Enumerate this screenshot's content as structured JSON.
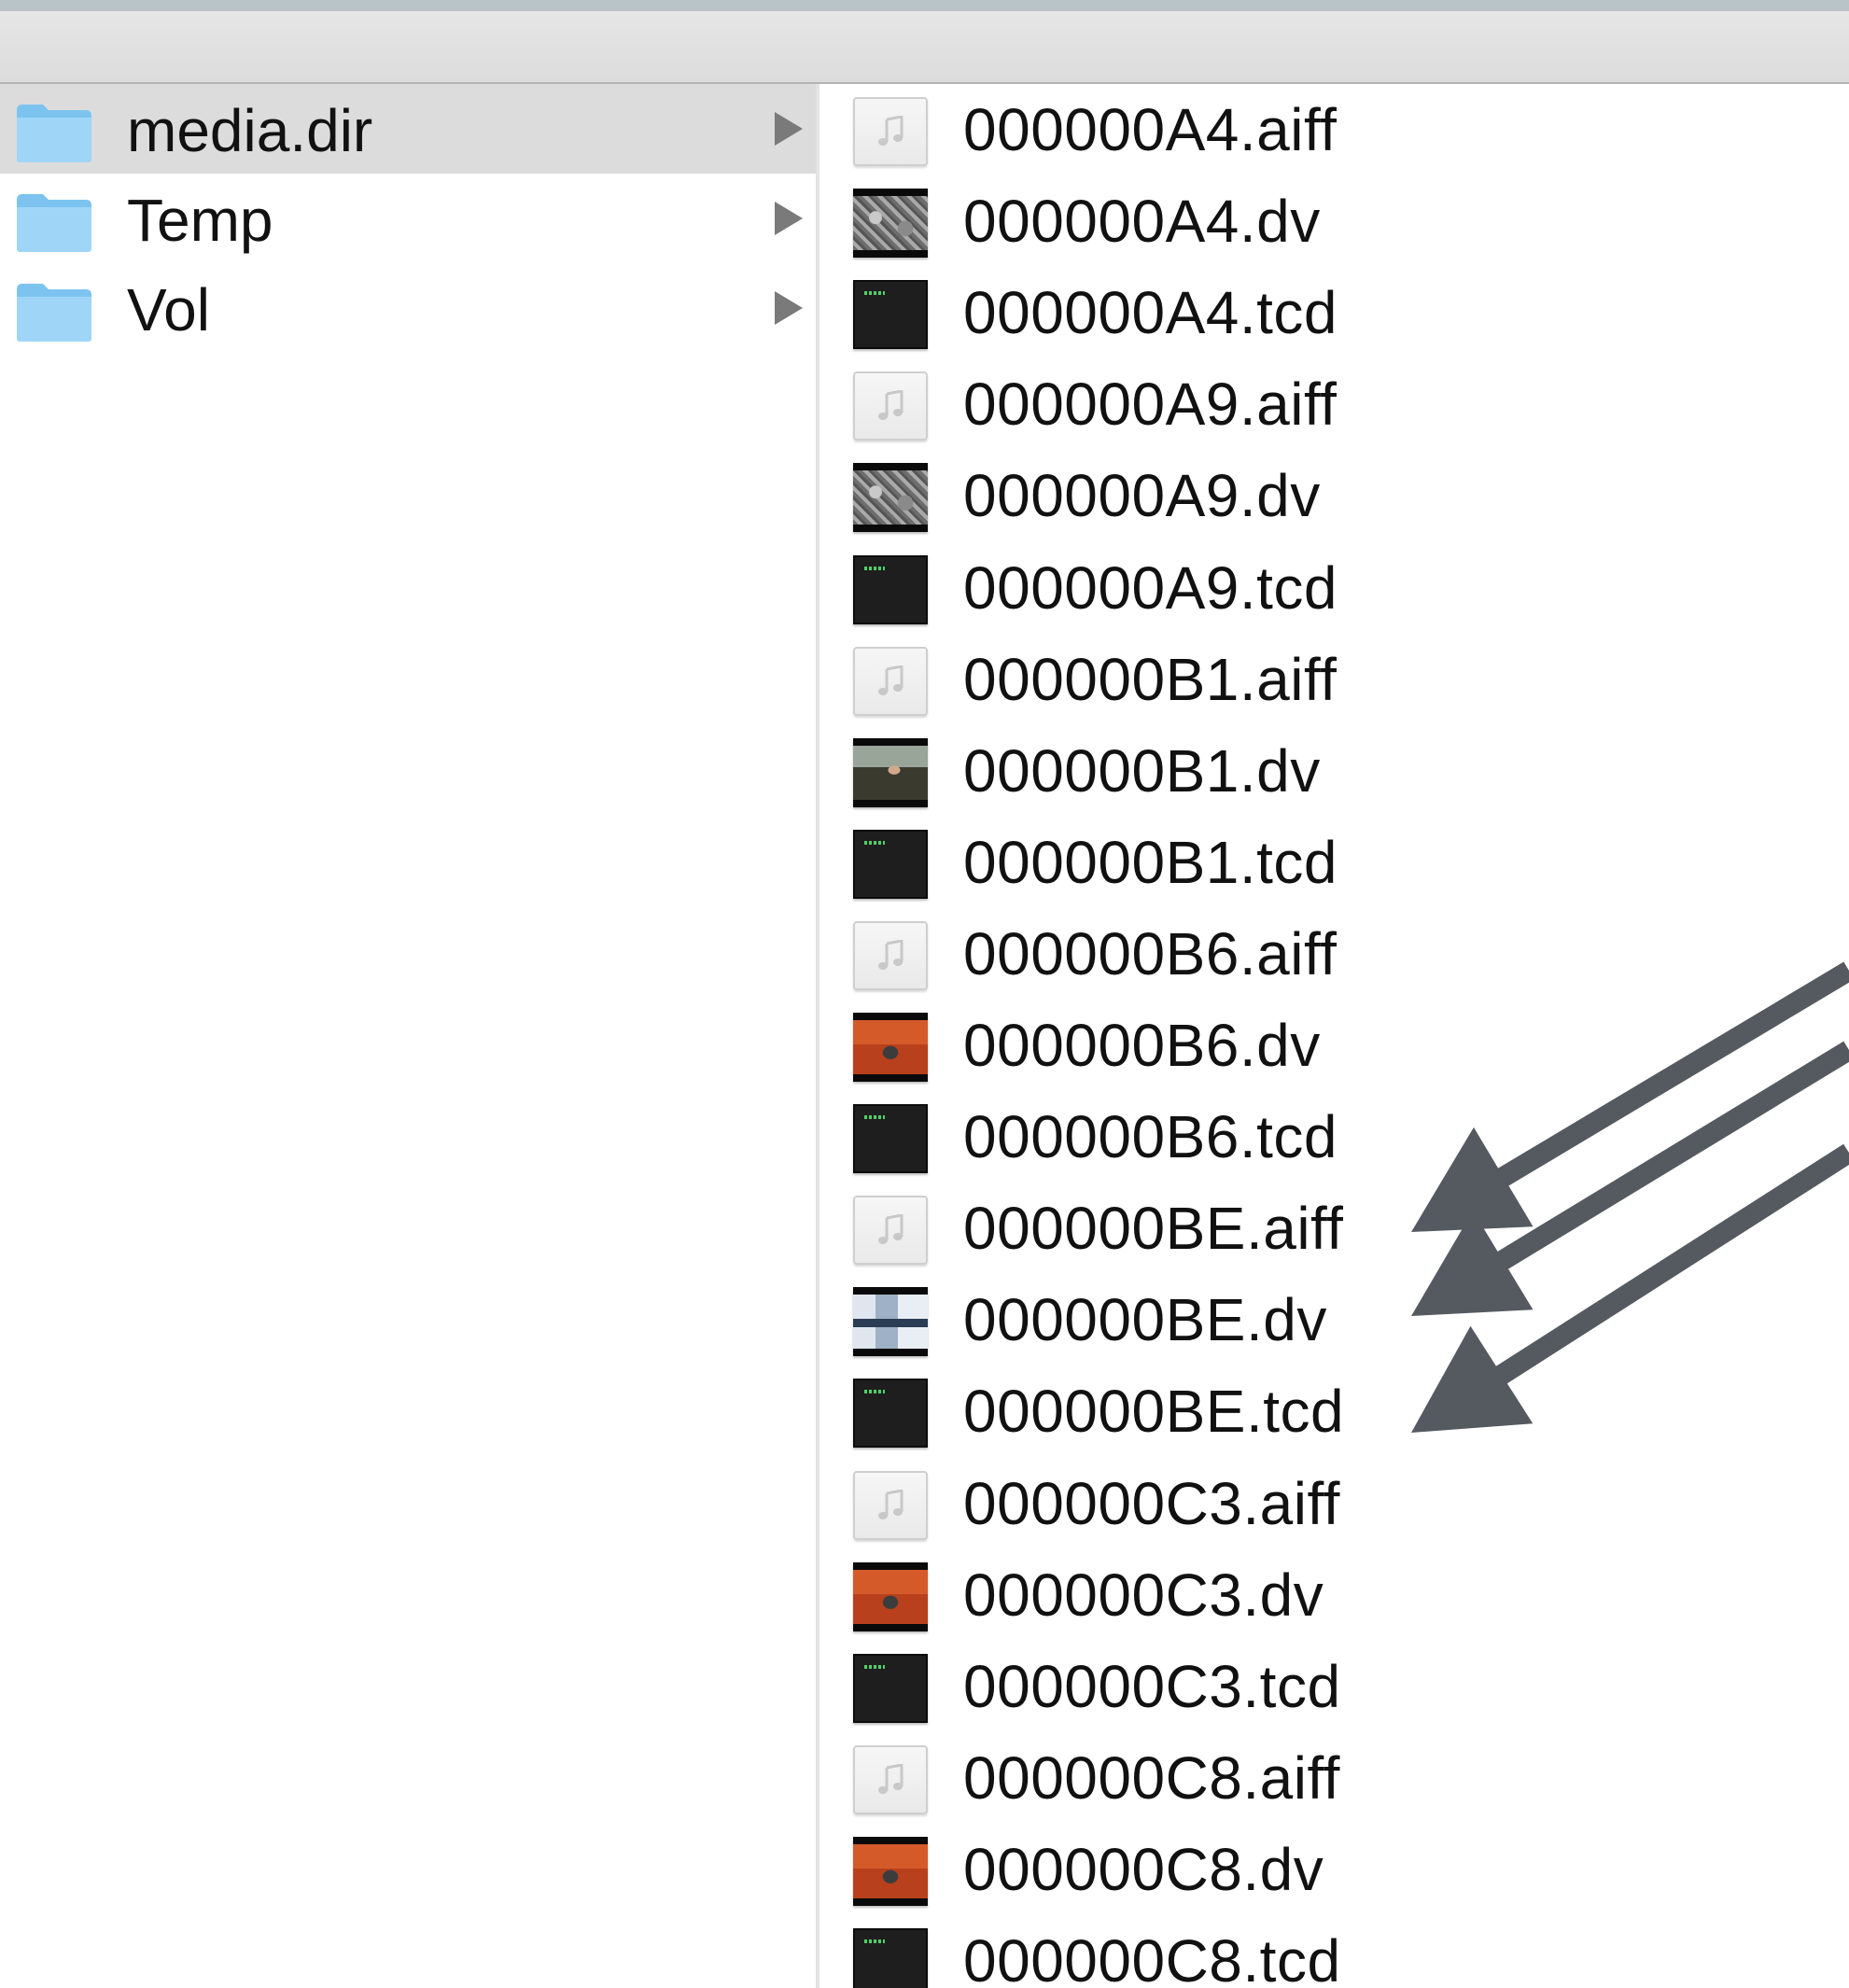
{
  "annotation_color": "#545a60",
  "folders": [
    {
      "label": "media.dir",
      "selected": true,
      "icon": "folder-icon"
    },
    {
      "label": "Temp",
      "selected": false,
      "icon": "folder-icon"
    },
    {
      "label": "Vol",
      "selected": false,
      "icon": "folder-icon"
    }
  ],
  "files": [
    {
      "name": "000000A4.aiff",
      "kind": "audio"
    },
    {
      "name": "000000A4.dv",
      "kind": "video-gray"
    },
    {
      "name": "000000A4.tcd",
      "kind": "tcd"
    },
    {
      "name": "000000A9.aiff",
      "kind": "audio"
    },
    {
      "name": "000000A9.dv",
      "kind": "video-gray"
    },
    {
      "name": "000000A9.tcd",
      "kind": "tcd"
    },
    {
      "name": "000000B1.aiff",
      "kind": "audio"
    },
    {
      "name": "000000B1.dv",
      "kind": "video-person"
    },
    {
      "name": "000000B1.tcd",
      "kind": "tcd"
    },
    {
      "name": "000000B6.aiff",
      "kind": "audio"
    },
    {
      "name": "000000B6.dv",
      "kind": "video-red"
    },
    {
      "name": "000000B6.tcd",
      "kind": "tcd"
    },
    {
      "name": "000000BE.aiff",
      "kind": "audio"
    },
    {
      "name": "000000BE.dv",
      "kind": "video-screen"
    },
    {
      "name": "000000BE.tcd",
      "kind": "tcd"
    },
    {
      "name": "000000C3.aiff",
      "kind": "audio"
    },
    {
      "name": "000000C3.dv",
      "kind": "video-red"
    },
    {
      "name": "000000C3.tcd",
      "kind": "tcd"
    },
    {
      "name": "000000C8.aiff",
      "kind": "audio"
    },
    {
      "name": "000000C8.dv",
      "kind": "video-red"
    },
    {
      "name": "000000C8.tcd",
      "kind": "tcd"
    }
  ]
}
